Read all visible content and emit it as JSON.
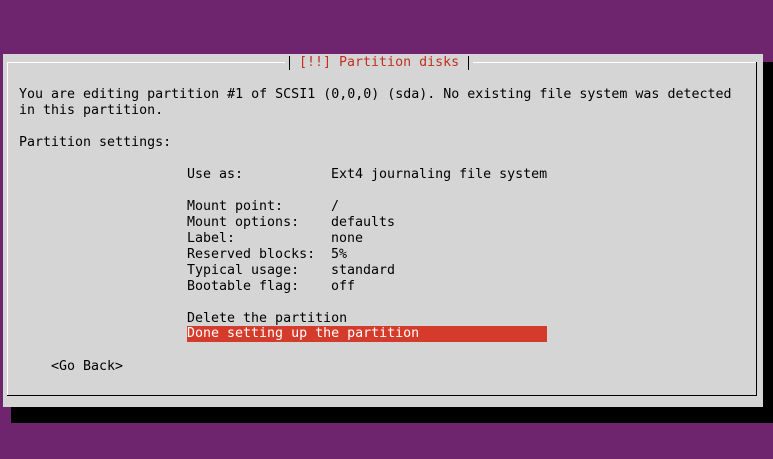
{
  "dialog": {
    "title": "[!!] Partition disks",
    "description_line1": "You are editing partition #1 of SCSI1 (0,0,0) (sda). No existing file system was detected",
    "description_line2": "in this partition.",
    "settings_heading": "Partition settings:"
  },
  "settings": [
    {
      "label": "Use as:",
      "value": "Ext4 journaling file system"
    },
    {
      "label": "Mount point:",
      "value": "/"
    },
    {
      "label": "Mount options:",
      "value": "defaults"
    },
    {
      "label": "Label:",
      "value": "none"
    },
    {
      "label": "Reserved blocks:",
      "value": "5%"
    },
    {
      "label": "Typical usage:",
      "value": "standard"
    },
    {
      "label": "Bootable flag:",
      "value": "off"
    }
  ],
  "actions": {
    "delete": "Delete the partition",
    "done": "Done setting up the partition"
  },
  "buttons": {
    "go_back": "<Go Back>"
  },
  "colors": {
    "background": "#6f246e",
    "dialog": "#d5d5d5",
    "title": "#c0301f",
    "selection": "#d43b2a"
  }
}
